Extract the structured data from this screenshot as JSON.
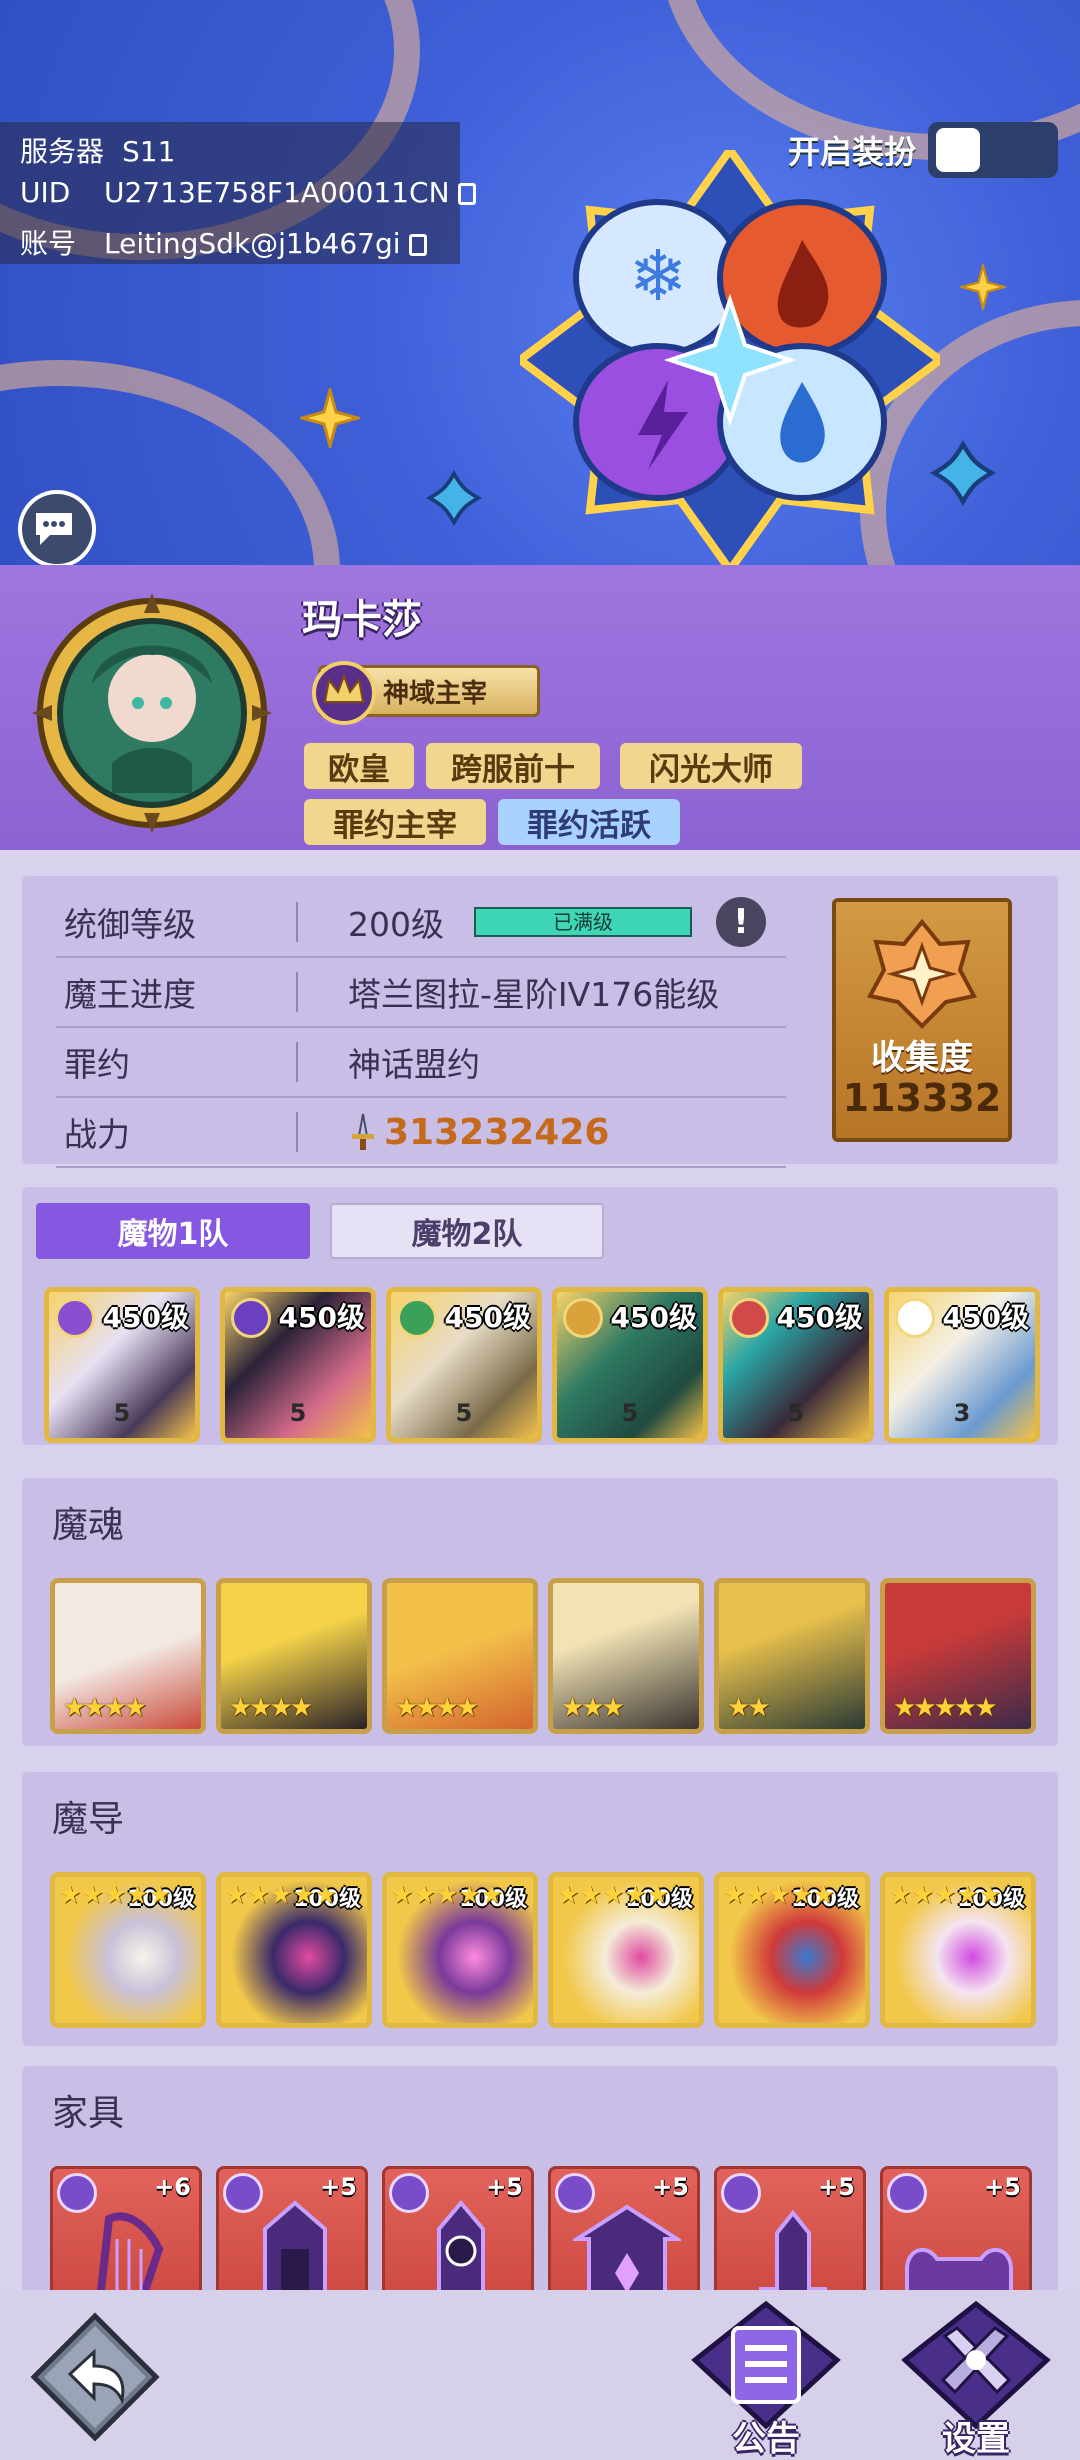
{
  "header": {
    "server_label": "服务器",
    "server_value": "S11",
    "uid_label": "UID",
    "uid_value": "U2713E758F1A00011CN",
    "account_label": "账号",
    "account_value": "LeitingSdk@j1b467gi",
    "skin_toggle_label": "开启装扮",
    "skin_toggle_on": false
  },
  "profile": {
    "name": "玛卡莎",
    "rank_badge": "神域主宰",
    "tags": [
      "欧皇",
      "跨服前十",
      "闪光大师",
      "罪约主宰",
      "罪约活跃"
    ]
  },
  "stats": {
    "rows": [
      {
        "label": "统御等级",
        "value": "200级",
        "badge": "已满级"
      },
      {
        "label": "魔王进度",
        "value": "塔兰图拉-星阶IV176能级"
      },
      {
        "label": "罪约",
        "value": "神话盟约"
      },
      {
        "label": "战力",
        "value": "313232426"
      }
    ],
    "collection_label": "收集度",
    "collection_value": "113332"
  },
  "teams": {
    "tabs": [
      "魔物1队",
      "魔物2队"
    ],
    "active_tab": 0,
    "units": [
      {
        "level": "450级",
        "stars": "5",
        "element_color": "#8a4fd0"
      },
      {
        "level": "450级",
        "stars": "5",
        "element_color": "#6a3fc0"
      },
      {
        "level": "450级",
        "stars": "5",
        "element_color": "#3aa05a"
      },
      {
        "level": "450级",
        "stars": "5",
        "element_color": "#d9a23a"
      },
      {
        "level": "450级",
        "stars": "5",
        "element_color": "#d04a4a"
      },
      {
        "level": "450级",
        "stars": "3",
        "element_color": "#ffffff"
      }
    ]
  },
  "souls": {
    "title": "魔魂",
    "items": [
      {
        "stars": "★★★★",
        "colors": [
          "#f3e9e4",
          "#c94a3a"
        ]
      },
      {
        "stars": "★★★★",
        "colors": [
          "#f4d24a",
          "#2a2228"
        ]
      },
      {
        "stars": "★★★★",
        "colors": [
          "#f3c04a",
          "#d3642e"
        ]
      },
      {
        "stars": "★★★",
        "colors": [
          "#f2e3b5",
          "#3a3530"
        ]
      },
      {
        "stars": "★★",
        "colors": [
          "#e8c04c",
          "#2a3a35"
        ]
      },
      {
        "stars": "★★★★★",
        "colors": [
          "#c63a3a",
          "#3a2a4a"
        ]
      }
    ]
  },
  "guides": {
    "title": "魔导",
    "items": [
      {
        "level": "100级",
        "stars": "★★★★★"
      },
      {
        "level": "100级",
        "stars": "★★★★★"
      },
      {
        "level": "100级",
        "stars": "★★★★★"
      },
      {
        "level": "100级",
        "stars": "★★★★★"
      },
      {
        "level": "100级",
        "stars": "★★★★★"
      },
      {
        "level": "100级",
        "stars": "★★★★★"
      }
    ]
  },
  "furniture": {
    "title": "家具",
    "items": [
      {
        "plus": "+6"
      },
      {
        "plus": "+5"
      },
      {
        "plus": "+5"
      },
      {
        "plus": "+5"
      },
      {
        "plus": "+5"
      },
      {
        "plus": "+5"
      }
    ]
  },
  "bottom": {
    "announcement": "公告",
    "settings": "设置"
  }
}
